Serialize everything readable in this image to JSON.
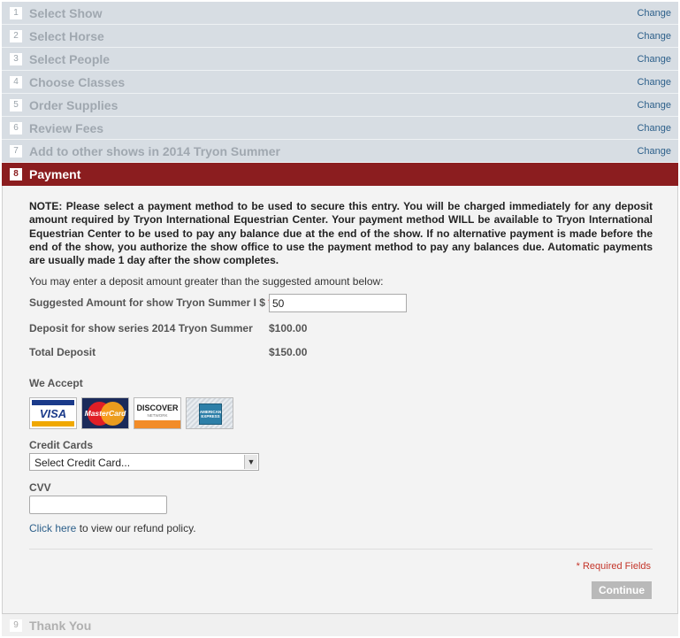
{
  "steps": [
    {
      "num": "1",
      "label": "Select Show",
      "change": "Change"
    },
    {
      "num": "2",
      "label": "Select Horse",
      "change": "Change"
    },
    {
      "num": "3",
      "label": "Select People",
      "change": "Change"
    },
    {
      "num": "4",
      "label": "Choose Classes",
      "change": "Change"
    },
    {
      "num": "5",
      "label": "Order Supplies",
      "change": "Change"
    },
    {
      "num": "6",
      "label": "Review Fees",
      "change": "Change"
    },
    {
      "num": "7",
      "label": "Add to other shows in 2014 Tryon Summer",
      "change": "Change"
    }
  ],
  "active_step": {
    "num": "8",
    "label": "Payment"
  },
  "payment": {
    "note": "NOTE: Please select a payment method to be used to secure this entry. You will be charged immediately for any deposit amount required by Tryon International Equestrian Center. Your payment method WILL be available to Tryon International Equestrian Center to be used to pay any balance due at the end of the show. If no alternative payment is made before the end of the show, you authorize the show office to use the payment method to pay any balances due. Automatic payments are usually made 1 day after the show completes.",
    "intro": "You may enter a deposit amount greater than the suggested amount below:",
    "suggested_label": "Suggested Amount for show Tryon Summer I $",
    "required_mark": "*",
    "suggested_value": "50",
    "series_label": "Deposit for show series 2014 Tryon Summer",
    "series_value": "$100.00",
    "total_label": "Total Deposit",
    "total_value": "$150.00",
    "we_accept": "We Accept",
    "cards": {
      "visa": "VISA",
      "mastercard": "MasterCard",
      "discover": "DISCOVER",
      "discover_sub": "NETWORK",
      "amex": "AMERICAN EXPRESS"
    },
    "credit_cards_label": "Credit Cards",
    "credit_card_select": "Select Credit Card...",
    "cvv_label": "CVV",
    "refund_link": "Click here",
    "refund_text": " to view our refund policy.",
    "required_fields": "* Required Fields",
    "continue": "Continue"
  },
  "final_step": {
    "num": "9",
    "label": "Thank You"
  },
  "colors": {
    "active_header": "#8b1d1f",
    "step_bg": "#d7dde3",
    "link": "#2c5f8a",
    "required": "#c4352a"
  }
}
